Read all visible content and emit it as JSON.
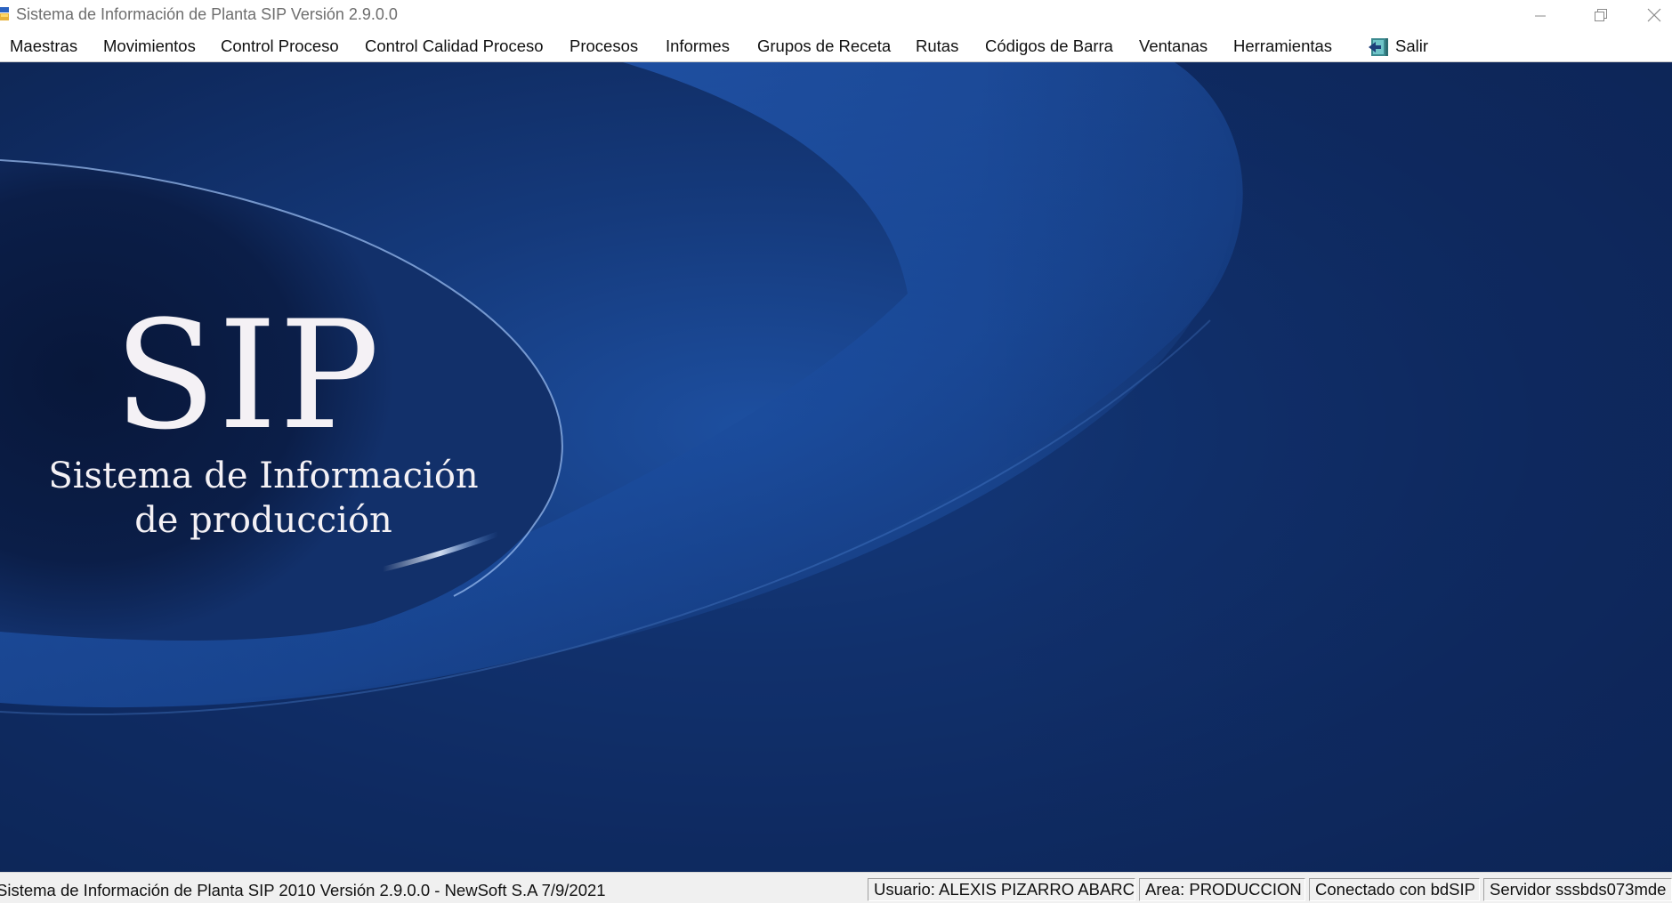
{
  "window": {
    "title": "Sistema de Información de Planta SIP Versión 2.9.0.0",
    "controls": {
      "minimize_icon": "minimize-icon",
      "restore_icon": "restore-icon",
      "close_icon": "close-icon"
    }
  },
  "menu": {
    "items": [
      {
        "label": "Maestras"
      },
      {
        "label": "Movimientos"
      },
      {
        "label": "Control Proceso"
      },
      {
        "label": "Control Calidad Proceso"
      },
      {
        "label": "Procesos"
      },
      {
        "label": "Informes"
      },
      {
        "label": "Grupos de Receta"
      },
      {
        "label": "Rutas"
      },
      {
        "label": "Códigos de Barra"
      },
      {
        "label": "Ventanas"
      },
      {
        "label": "Herramientas"
      },
      {
        "label": "Salir",
        "icon": "exit-icon"
      }
    ]
  },
  "splash": {
    "logo_text": "SIP",
    "subtitle_line1": "Sistema de Información",
    "subtitle_line2": "de producción"
  },
  "status": {
    "main_text": "Sistema de Información de Planta SIP 2010 Versión 2.9.0.0 - NewSoft S.A 7/9/2021",
    "usuario": "Usuario: ALEXIS PIZARRO ABARCA",
    "area": "Area: PRODUCCION",
    "conexion": "Conectado con bdSIP",
    "servidor": "Servidor sssbds073mde"
  },
  "colors": {
    "background_blue": "#153a7c",
    "highlight_blue": "#3d7fe0",
    "logo_text": "#f4f1f5"
  }
}
